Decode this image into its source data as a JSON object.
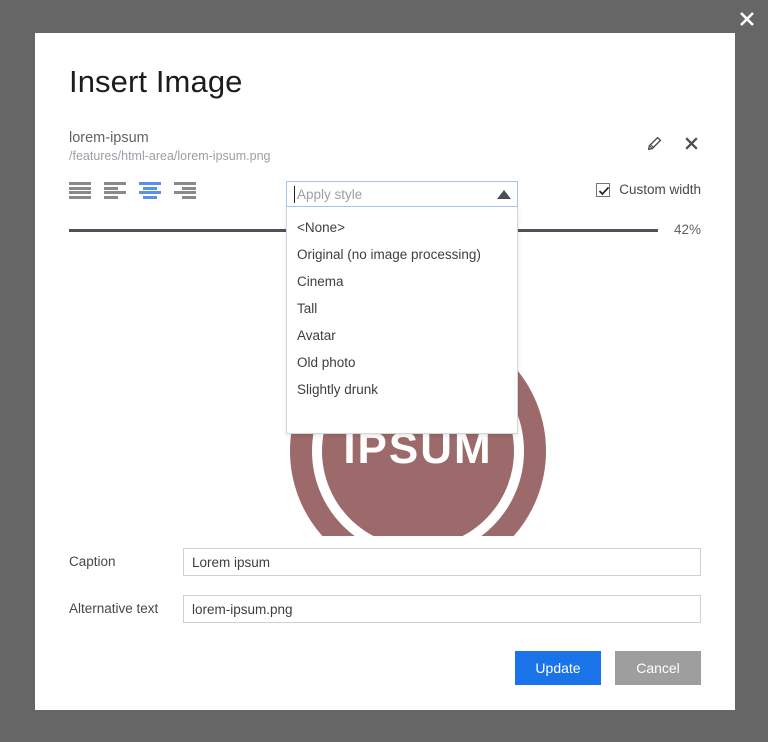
{
  "backdrop": {
    "close_icon": "close-icon"
  },
  "dialog": {
    "title": "Insert Image",
    "file": {
      "name": "lorem-ipsum",
      "path": "/features/html-area/lorem-ipsum.png",
      "edit_icon": "pencil-icon",
      "remove_icon": "close-icon"
    },
    "alignment": {
      "options": [
        {
          "name": "justify",
          "icon": "align-justify-icon",
          "active": false
        },
        {
          "name": "left",
          "icon": "align-left-icon",
          "active": false
        },
        {
          "name": "center",
          "icon": "align-center-icon",
          "active": true
        },
        {
          "name": "right",
          "icon": "align-right-icon",
          "active": false
        }
      ]
    },
    "custom_width": {
      "label": "Custom width",
      "checked": true,
      "checkbox_icon": "checkmark-icon"
    },
    "slider": {
      "value_label": "42%",
      "percent": 42
    },
    "style_dropdown": {
      "placeholder": "Apply style",
      "value": "",
      "expanded": true,
      "arrow_icon": "chevron-up-icon",
      "options": [
        "<None>",
        "Original (no image processing)",
        "Cinema",
        "Tall",
        "Avatar",
        "Old photo",
        "Slightly drunk"
      ]
    },
    "preview": {
      "logo_wordmark": "IPSUM",
      "logo_color": "#9c6a6a"
    },
    "fields": [
      {
        "label": "Caption",
        "value": "Lorem ipsum",
        "name": "caption"
      },
      {
        "label": "Alternative text",
        "value": "lorem-ipsum.png",
        "name": "alt-text"
      }
    ],
    "buttons": {
      "primary": "Update",
      "secondary": "Cancel"
    }
  },
  "colors": {
    "backdrop": "#666666",
    "primary": "#1a73e8",
    "secondary": "#9e9e9e",
    "accent_active": "#5b8fec",
    "logo": "#9c6a6a"
  }
}
